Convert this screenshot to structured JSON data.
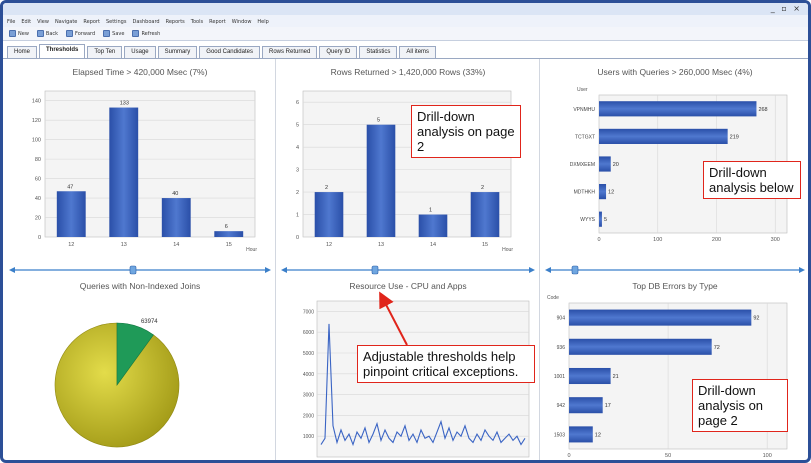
{
  "window": {
    "menu": [
      "File",
      "Edit",
      "View",
      "Navigate",
      "Report",
      "Settings",
      "Dashboard",
      "Reports",
      "Tools",
      "Report",
      "Window",
      "Help"
    ],
    "controls": "_ ▫ ×"
  },
  "toolbar": [
    {
      "label": "New",
      "icon": "new-icon"
    },
    {
      "label": "Back",
      "icon": "back-icon"
    },
    {
      "label": "Forward",
      "icon": "forward-icon"
    },
    {
      "label": "Save",
      "icon": "save-icon"
    },
    {
      "label": "Refresh",
      "icon": "refresh-icon"
    }
  ],
  "tabs": [
    "Home",
    "Thresholds",
    "Top Ten",
    "Usage",
    "Summary",
    "Good Candidates",
    "Rows Returned",
    "Query ID",
    "Statistics",
    "All items"
  ],
  "active_tab": 1,
  "colors": {
    "bar": "#2a4fa8",
    "bar_light": "#4f78cf",
    "pie": "#c6bf28",
    "pie_slice": "#1f9a58",
    "line": "#3a64c4",
    "callout_border": "#e0251b",
    "slider": "#3b7fc9"
  },
  "panels": {
    "elapsed": {
      "title": "Elapsed Time > 420,000 Msec (7%)"
    },
    "rows": {
      "title": "Rows Returned > 1,420,000 Rows (33%)"
    },
    "users": {
      "title": "Users with Queries > 260,000 Msec (4%)"
    },
    "nonindexed": {
      "title": "Queries with Non-Indexed Joins"
    },
    "resource": {
      "title": "Resource Use - CPU and Apps"
    },
    "dberrors": {
      "title": "Top DB Errors by Type"
    }
  },
  "callouts": {
    "c1": "Drill-down analysis on page 2",
    "c2": "Drill-down analysis below",
    "c3": "Adjustable thresholds help pinpoint critical exceptions.",
    "c4": "Drill-down analysis on page 2"
  },
  "chart_data": [
    {
      "type": "bar",
      "title": "Elapsed Time > 420,000 Msec (7%)",
      "categories": [
        "12",
        "13",
        "14",
        "15"
      ],
      "values": [
        47,
        133,
        40,
        6
      ],
      "data_labels": [
        "47",
        "133",
        "40",
        "6"
      ],
      "yticks": [
        "0",
        "20",
        "40",
        "60",
        "80",
        "100",
        "120",
        "140"
      ],
      "ylim": [
        0,
        150
      ],
      "xlabel": "Hour",
      "grid": true
    },
    {
      "type": "bar",
      "title": "Rows Returned > 1,420,000 Rows (33%)",
      "categories": [
        "12",
        "13",
        "14",
        "15"
      ],
      "values": [
        2,
        5,
        1,
        2
      ],
      "data_labels": [
        "2",
        "5",
        "1",
        "2"
      ],
      "yticks": [
        "0",
        "1",
        "2",
        "3",
        "4",
        "5",
        "6"
      ],
      "ylim": [
        0,
        6.5
      ],
      "xlabel": "Hour",
      "grid": true
    },
    {
      "type": "bar",
      "orientation": "horizontal",
      "title": "Users with Queries > 260,000 Msec (4%)",
      "categories": [
        "VPNMHU",
        "TCTGXT",
        "DXMXEEM",
        "MDTHKH",
        "WYYS"
      ],
      "values": [
        268,
        219,
        20,
        12,
        5
      ],
      "data_labels": [
        "268",
        "219",
        "20",
        "12",
        "5"
      ],
      "xticks": [
        "0",
        "100",
        "200",
        "300"
      ],
      "xlim": [
        0,
        320
      ],
      "ylabel": "User",
      "grid": true
    },
    {
      "type": "pie",
      "title": "Queries with Non-Indexed Joins",
      "slices": [
        {
          "label": "",
          "value": 90
        },
        {
          "label": "63974",
          "value": 10
        }
      ]
    },
    {
      "type": "line",
      "title": "Resource Use - CPU and Apps",
      "yticks": [
        "1000",
        "2000",
        "3000",
        "4000",
        "5000",
        "6000",
        "7000"
      ],
      "ylim": [
        0,
        7500
      ],
      "values": [
        600,
        900,
        6400,
        1500,
        700,
        1300,
        800,
        1100,
        600,
        1200,
        900,
        1400,
        700,
        1100,
        1600,
        800,
        1300,
        900,
        700,
        1200,
        1000,
        1500,
        800,
        1100,
        700,
        1300,
        900,
        1000,
        700,
        1200,
        1700,
        900,
        1400,
        800,
        1200,
        1000,
        1500,
        900,
        700,
        1100,
        800,
        1300,
        1000,
        800,
        1200,
        700,
        900,
        1100,
        800,
        1000,
        600,
        900
      ],
      "grid": true
    },
    {
      "type": "bar",
      "orientation": "horizontal",
      "title": "Top DB Errors by Type",
      "categories": [
        "904",
        "936",
        "1001",
        "942",
        "1503"
      ],
      "values": [
        92,
        72,
        21,
        17,
        12
      ],
      "data_labels": [
        "92",
        "72",
        "21",
        "17",
        "12"
      ],
      "xticks": [
        "0",
        "50",
        "100"
      ],
      "xlim": [
        0,
        110
      ],
      "ylabel": "Code",
      "grid": true
    }
  ]
}
